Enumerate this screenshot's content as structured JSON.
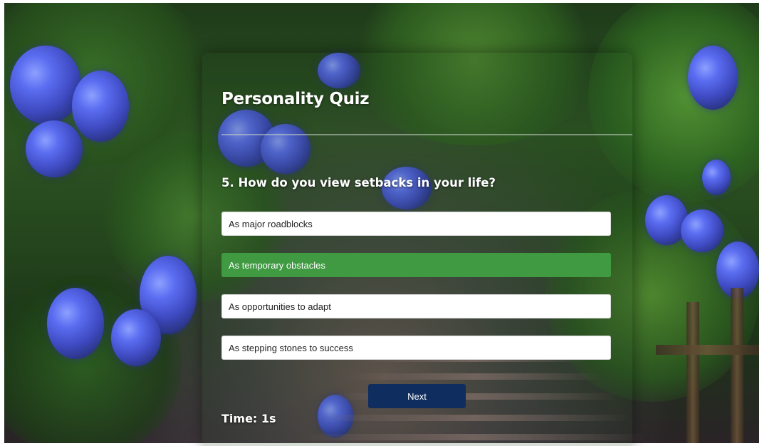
{
  "quiz": {
    "title": "Personality Quiz",
    "question": "5. How do you view setbacks in your life?",
    "options": [
      {
        "label": "As major roadblocks",
        "selected": false
      },
      {
        "label": "As temporary obstacles",
        "selected": true
      },
      {
        "label": "As opportunities to adapt",
        "selected": false
      },
      {
        "label": "As stepping stones to success",
        "selected": false
      }
    ],
    "next_label": "Next",
    "timer": "Time: 1s"
  },
  "colors": {
    "selected_option": "#3f9a42",
    "next_button": "#0f2d5e",
    "text_light": "#ffffff"
  },
  "background": {
    "description_icon": "garden-stairs-hydrangea-image"
  }
}
